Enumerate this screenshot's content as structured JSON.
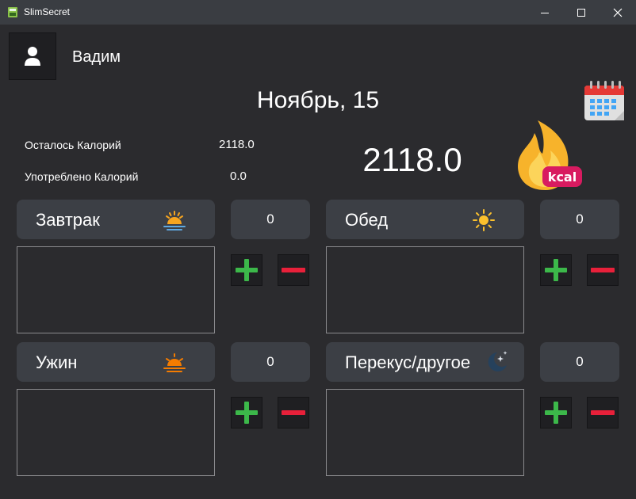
{
  "window": {
    "title": "SlimSecret"
  },
  "user": {
    "name": "Вадим",
    "icon": "user-icon"
  },
  "date": {
    "label": "Ноябрь, 15"
  },
  "stats": {
    "remaining_label": "Осталось Калорий",
    "remaining_value": "2118.0",
    "consumed_label": "Употреблено Калорий",
    "consumed_value": "0.0",
    "big_value": "2118.0",
    "badge": "kcal"
  },
  "meals": {
    "breakfast": {
      "label": "Завтрак",
      "count": "0",
      "icon": "sunrise-icon"
    },
    "lunch": {
      "label": "Обед",
      "count": "0",
      "icon": "sun-icon"
    },
    "dinner": {
      "label": "Ужин",
      "count": "0",
      "icon": "sunset-icon"
    },
    "snack": {
      "label": "Перекус/другое",
      "count": "0",
      "icon": "moon-stars-icon"
    }
  },
  "colors": {
    "background": "#2b2b2e",
    "panel": "#3c3f45",
    "plus": "#3cb84a",
    "minus": "#e8203a",
    "flame": "#f7b32b",
    "badge": "#d81b60"
  }
}
